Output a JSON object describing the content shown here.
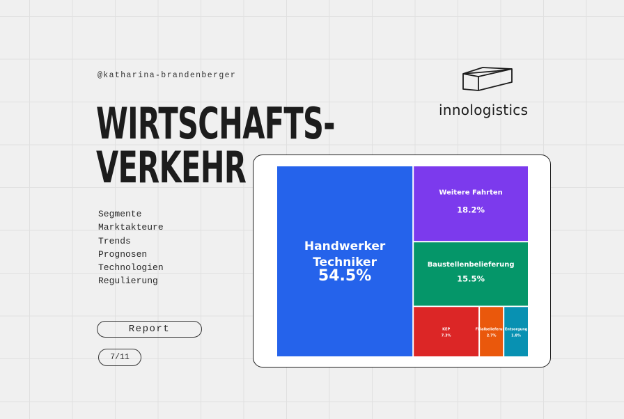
{
  "author": {
    "handle": "@katharina-brandenberger"
  },
  "title": {
    "line1": "WIRTSCHAFTS-",
    "line2": "VERKEHR"
  },
  "topics": [
    "Segmente",
    "Marktakteure",
    "Trends",
    "Prognosen",
    "Technologien",
    "Regulierung"
  ],
  "report_button": {
    "label": "Report"
  },
  "pagination": {
    "label": "7/11"
  },
  "brand": {
    "name": "innologistics",
    "icon": "box-outline-icon"
  },
  "colors": {
    "background": "#f0f0f0",
    "grid": "#e0e0e0",
    "text": "#1c1c1c"
  },
  "chart_data": {
    "type": "treemap",
    "unit": "%",
    "segments": [
      {
        "label": "Handwerker\nTechniker",
        "value": 54.5,
        "value_label": "54.5%",
        "color": "#2563eb"
      },
      {
        "label": "Weitere Fahrten",
        "value": 18.2,
        "value_label": "18.2%",
        "color": "#7c3aed"
      },
      {
        "label": "Baustellenbelieferung",
        "value": 15.5,
        "value_label": "15.5%",
        "color": "#059669"
      },
      {
        "label": "KEP",
        "value": 7.3,
        "value_label": "7.3%",
        "color": "#dc2626"
      },
      {
        "label": "Filialbelieferung",
        "value": 2.7,
        "value_label": "2.7%",
        "color": "#ea580c"
      },
      {
        "label": "Entsorgung",
        "value": 1.8,
        "value_label": "1.8%",
        "color": "#0891b2"
      }
    ]
  }
}
